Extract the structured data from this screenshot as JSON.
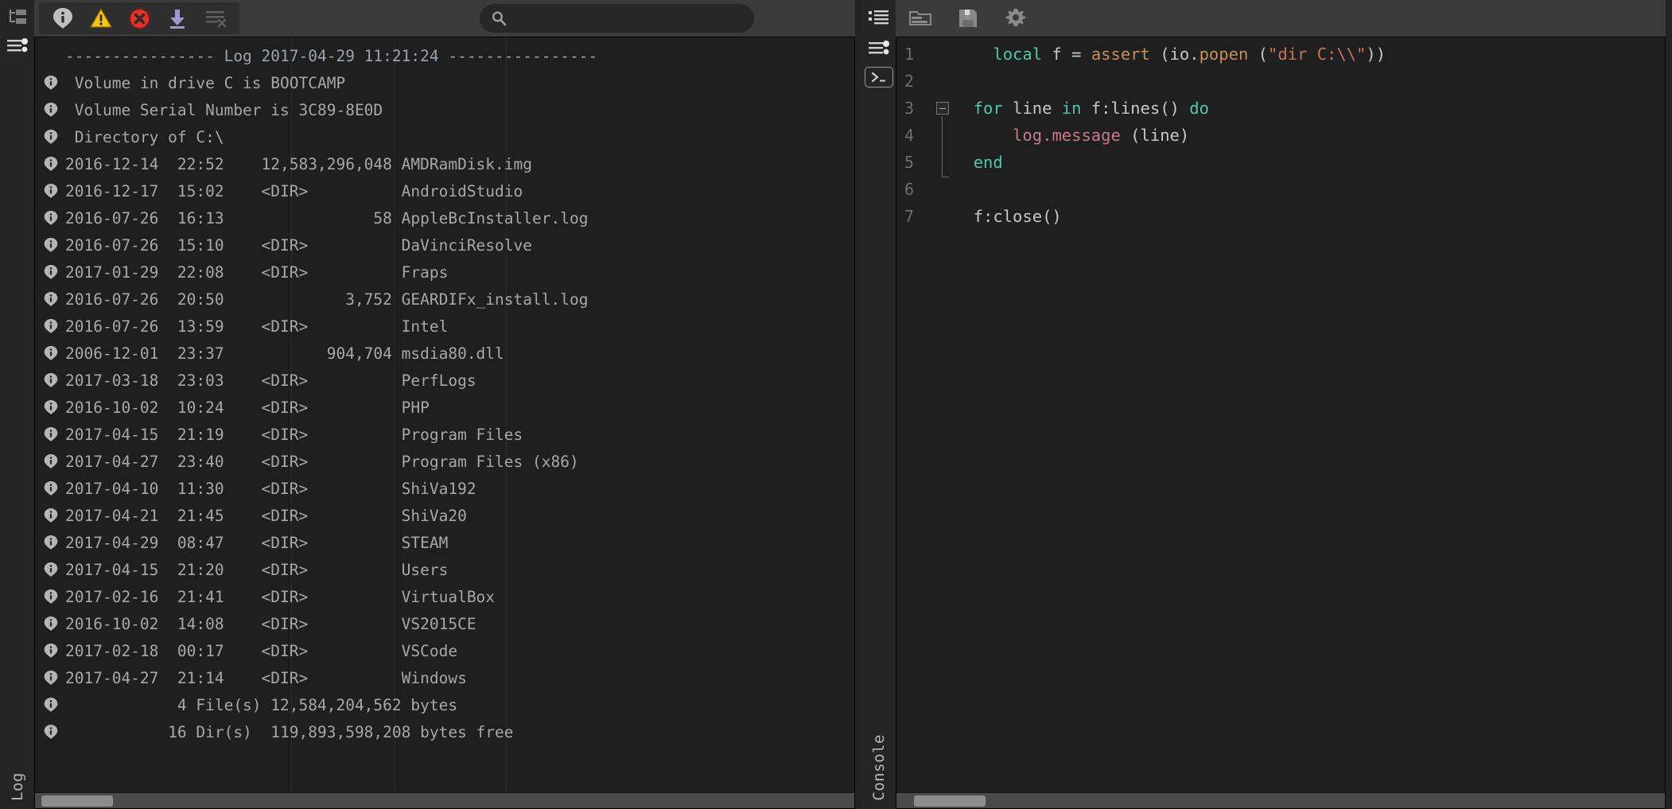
{
  "left_rail": {
    "icons": [
      {
        "name": "hierarchy-tree-icon",
        "label": "Hierarchy"
      },
      {
        "name": "log-settings-icon",
        "label": "Log Settings"
      }
    ],
    "vertical_label": "Log"
  },
  "log_panel": {
    "toolbar": {
      "buttons": [
        {
          "name": "filter-info-button",
          "icon": "info-icon",
          "label": "Info"
        },
        {
          "name": "filter-warning-button",
          "icon": "warning-icon",
          "label": "Warning"
        },
        {
          "name": "filter-error-button",
          "icon": "error-icon",
          "label": "Error"
        },
        {
          "name": "export-log-button",
          "icon": "download-icon",
          "label": "Export"
        },
        {
          "name": "clear-log-button",
          "icon": "clear-list-icon",
          "label": "Clear"
        }
      ],
      "search": {
        "value": "",
        "placeholder": ""
      }
    },
    "header_line": "---------------- Log 2017-04-29 11:21:24 ----------------",
    "rows": [
      {
        "icon": "info-icon",
        "text": " Volume in drive C is BOOTCAMP"
      },
      {
        "icon": "info-icon",
        "text": " Volume Serial Number is 3C89-8E0D"
      },
      {
        "icon": "info-icon",
        "text": " Directory of C:\\"
      },
      {
        "icon": "info-icon",
        "text": "2016-12-14  22:52    12,583,296,048 AMDRamDisk.img"
      },
      {
        "icon": "info-icon",
        "text": "2016-12-17  15:02    <DIR>          AndroidStudio"
      },
      {
        "icon": "info-icon",
        "text": "2016-07-26  16:13                58 AppleBcInstaller.log"
      },
      {
        "icon": "info-icon",
        "text": "2016-07-26  15:10    <DIR>          DaVinciResolve"
      },
      {
        "icon": "info-icon",
        "text": "2017-01-29  22:08    <DIR>          Fraps"
      },
      {
        "icon": "info-icon",
        "text": "2016-07-26  20:50             3,752 GEARDIFx_install.log"
      },
      {
        "icon": "info-icon",
        "text": "2016-07-26  13:59    <DIR>          Intel"
      },
      {
        "icon": "info-icon",
        "text": "2006-12-01  23:37           904,704 msdia80.dll"
      },
      {
        "icon": "info-icon",
        "text": "2017-03-18  23:03    <DIR>          PerfLogs"
      },
      {
        "icon": "info-icon",
        "text": "2016-10-02  10:24    <DIR>          PHP"
      },
      {
        "icon": "info-icon",
        "text": "2017-04-15  21:19    <DIR>          Program Files"
      },
      {
        "icon": "info-icon",
        "text": "2017-04-27  23:40    <DIR>          Program Files (x86)"
      },
      {
        "icon": "info-icon",
        "text": "2017-04-10  11:30    <DIR>          ShiVa192"
      },
      {
        "icon": "info-icon",
        "text": "2017-04-21  21:45    <DIR>          ShiVa20"
      },
      {
        "icon": "info-icon",
        "text": "2017-04-29  08:47    <DIR>          STEAM"
      },
      {
        "icon": "info-icon",
        "text": "2017-04-15  21:20    <DIR>          Users"
      },
      {
        "icon": "info-icon",
        "text": "2017-02-16  21:41    <DIR>          VirtualBox"
      },
      {
        "icon": "info-icon",
        "text": "2016-10-02  14:08    <DIR>          VS2015CE"
      },
      {
        "icon": "info-icon",
        "text": "2017-02-18  00:17    <DIR>          VSCode"
      },
      {
        "icon": "info-icon",
        "text": "2017-04-27  21:14    <DIR>          Windows"
      },
      {
        "icon": "info-icon",
        "text": "            4 File(s) 12,584,204,562 bytes"
      },
      {
        "icon": "info-icon",
        "text": "           16 Dir(s)  119,893,598,208 bytes free"
      }
    ]
  },
  "middle_rail": {
    "icons": [
      {
        "name": "log-list-icon",
        "label": "Log List"
      },
      {
        "name": "log-filter-icon",
        "label": "Log Filter"
      },
      {
        "name": "console-prompt-icon",
        "label": "Console Prompt"
      }
    ],
    "vertical_label": "Console"
  },
  "editor_panel": {
    "toolbar": {
      "buttons": [
        {
          "name": "open-folder-button",
          "icon": "folder-open-icon",
          "label": "Open"
        },
        {
          "name": "save-button",
          "icon": "save-disk-icon",
          "label": "Save"
        },
        {
          "name": "settings-button",
          "icon": "gear-icon",
          "label": "Settings"
        }
      ]
    },
    "line_numbers": [
      "1",
      "2",
      "3",
      "4",
      "5",
      "6",
      "7"
    ],
    "code_lines": [
      {
        "n": "1",
        "tokens": [
          {
            "t": "    ",
            "c": "plain"
          },
          {
            "t": "local",
            "c": "kw"
          },
          {
            "t": " f = ",
            "c": "plain"
          },
          {
            "t": "assert",
            "c": "fn"
          },
          {
            "t": " (",
            "c": "plain"
          },
          {
            "t": "io",
            "c": "plain"
          },
          {
            "t": ".",
            "c": "plain"
          },
          {
            "t": "popen",
            "c": "fn"
          },
          {
            "t": " (",
            "c": "plain"
          },
          {
            "t": "\"dir C:\\\\\"",
            "c": "str"
          },
          {
            "t": "))",
            "c": "plain"
          }
        ]
      },
      {
        "n": "2",
        "tokens": []
      },
      {
        "n": "3",
        "tokens": [
          {
            "t": "  ",
            "c": "plain"
          },
          {
            "t": "for",
            "c": "kw"
          },
          {
            "t": " line ",
            "c": "plain"
          },
          {
            "t": "in",
            "c": "kw"
          },
          {
            "t": " f:",
            "c": "plain"
          },
          {
            "t": "lines",
            "c": "plain"
          },
          {
            "t": "() ",
            "c": "plain"
          },
          {
            "t": "do",
            "c": "kw"
          }
        ]
      },
      {
        "n": "4",
        "tokens": [
          {
            "t": "      ",
            "c": "plain"
          },
          {
            "t": "log",
            "c": "mem"
          },
          {
            "t": ".",
            "c": "mem"
          },
          {
            "t": "message",
            "c": "mem"
          },
          {
            "t": " (line)",
            "c": "plain"
          }
        ]
      },
      {
        "n": "5",
        "tokens": [
          {
            "t": "  ",
            "c": "plain"
          },
          {
            "t": "end",
            "c": "kw"
          }
        ]
      },
      {
        "n": "6",
        "tokens": []
      },
      {
        "n": "7",
        "tokens": [
          {
            "t": "  ",
            "c": "plain"
          },
          {
            "t": "f:close()",
            "c": "plain"
          }
        ]
      }
    ],
    "code_plain": [
      "    local f = assert (io.popen (\"dir C:\\\\\"))",
      "",
      "  for line in f:lines() do",
      "      log.message (line)",
      "  end",
      "",
      "  f:close()"
    ]
  },
  "colors": {
    "background": "#232323",
    "panel": "#1f1f1f",
    "toolbar": "#3b3b3b",
    "rail": "#252525",
    "log_text": "#a8a8a8",
    "keyword": "#4ec9a8",
    "function": "#c98f5a",
    "string": "#c0785a",
    "member": "#c87a8a",
    "warning": "#f0c419",
    "error": "#e23c33",
    "download": "#9b93c9",
    "scrollbar_thumb": "#8d8d8d"
  }
}
